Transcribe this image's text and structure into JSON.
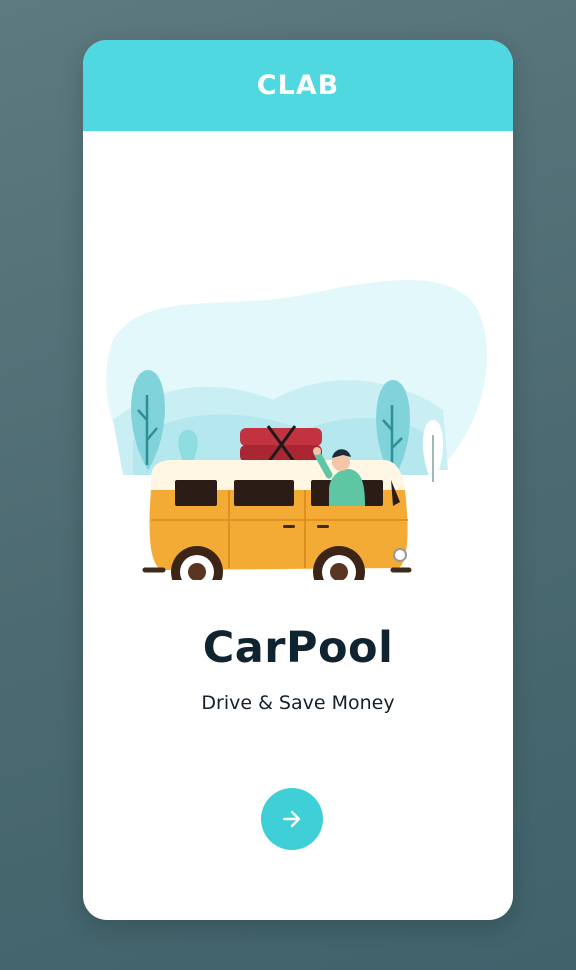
{
  "header": {
    "logo_text": "CLAB",
    "background_color": "#4fd8df"
  },
  "hero": {
    "illustration": "van-with-driver-illustration",
    "title": "CarPool",
    "subtitle": "Drive & Save Money"
  },
  "next_button": {
    "icon": "arrow-right-icon",
    "color": "#3fcfd6"
  },
  "colors": {
    "accent": "#3fcfd6",
    "title_text": "#0f2330",
    "van_body": "#f4ab35",
    "roof_luggage": "#c2323f"
  }
}
